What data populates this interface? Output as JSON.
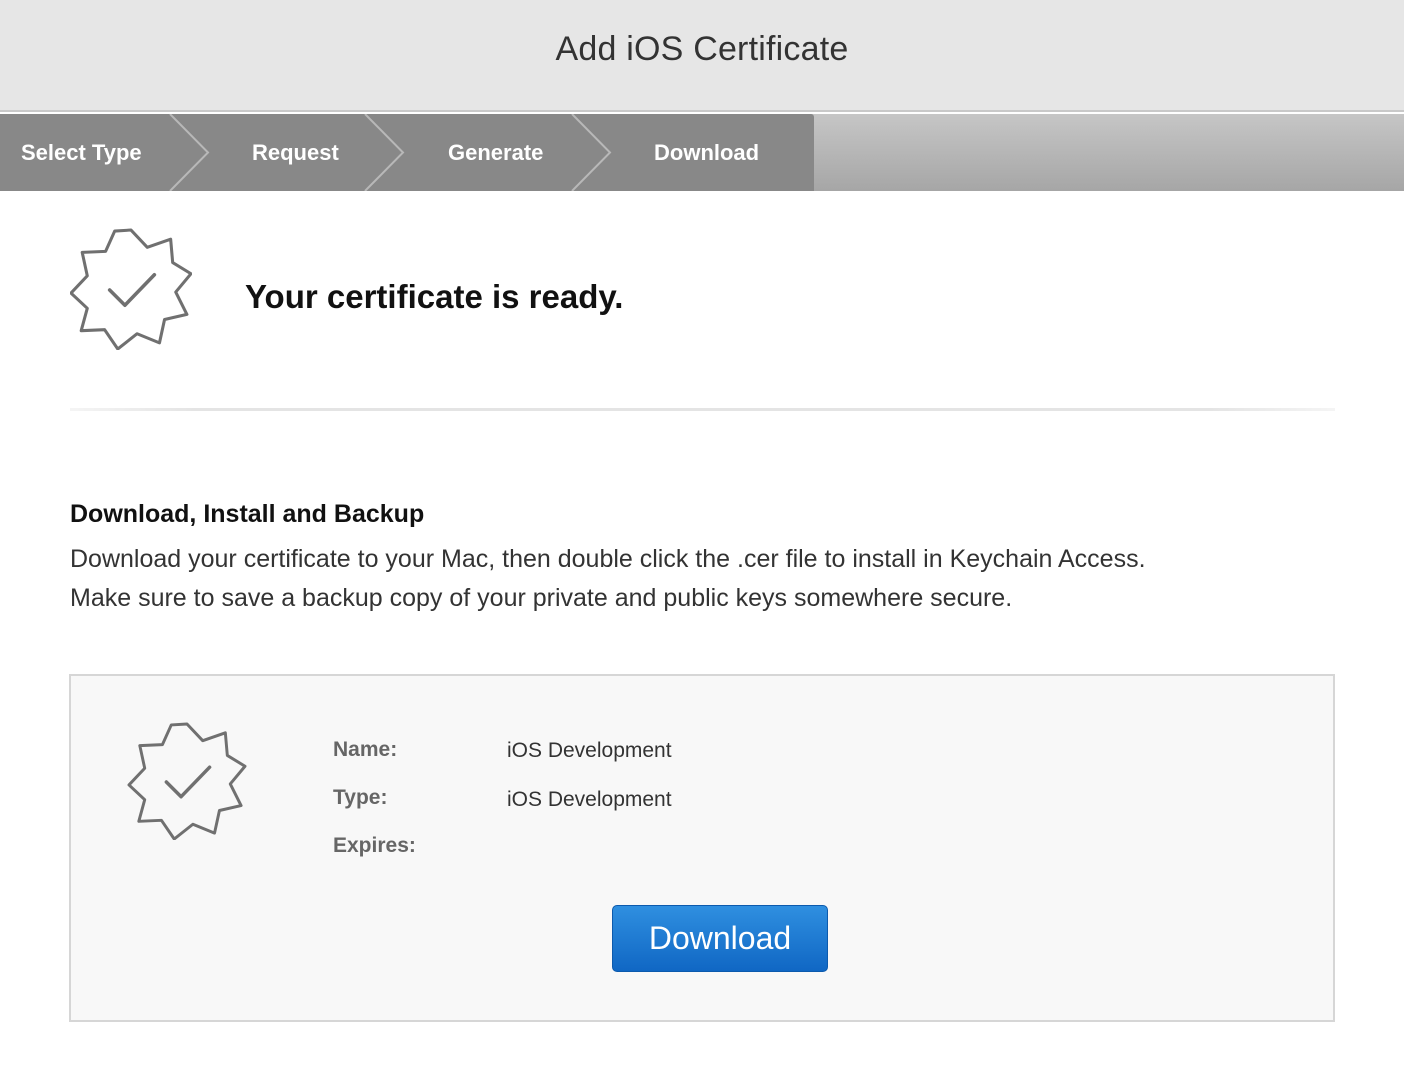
{
  "header": {
    "title": "Add iOS Certificate"
  },
  "steps": [
    {
      "label": "Select Type"
    },
    {
      "label": "Request"
    },
    {
      "label": "Generate"
    },
    {
      "label": "Download"
    }
  ],
  "ready": {
    "icon": "certificate-badge-icon",
    "title": "Your certificate is ready."
  },
  "instructions": {
    "heading": "Download, Install and Backup",
    "line1": "Download your certificate to your Mac, then double click the .cer file to install in Keychain Access.",
    "line2": "Make sure to save a backup copy of your private and public keys somewhere secure."
  },
  "certificate": {
    "icon": "certificate-badge-icon",
    "name_label": "Name:",
    "name_value": "iOS Development",
    "type_label": "Type:",
    "type_value": "iOS Development",
    "expires_label": "Expires:",
    "expires_value": "",
    "download_label": "Download"
  },
  "colors": {
    "accent": "#1a78d4",
    "steps_active": "#888888",
    "header_bg": "#e6e6e6"
  }
}
